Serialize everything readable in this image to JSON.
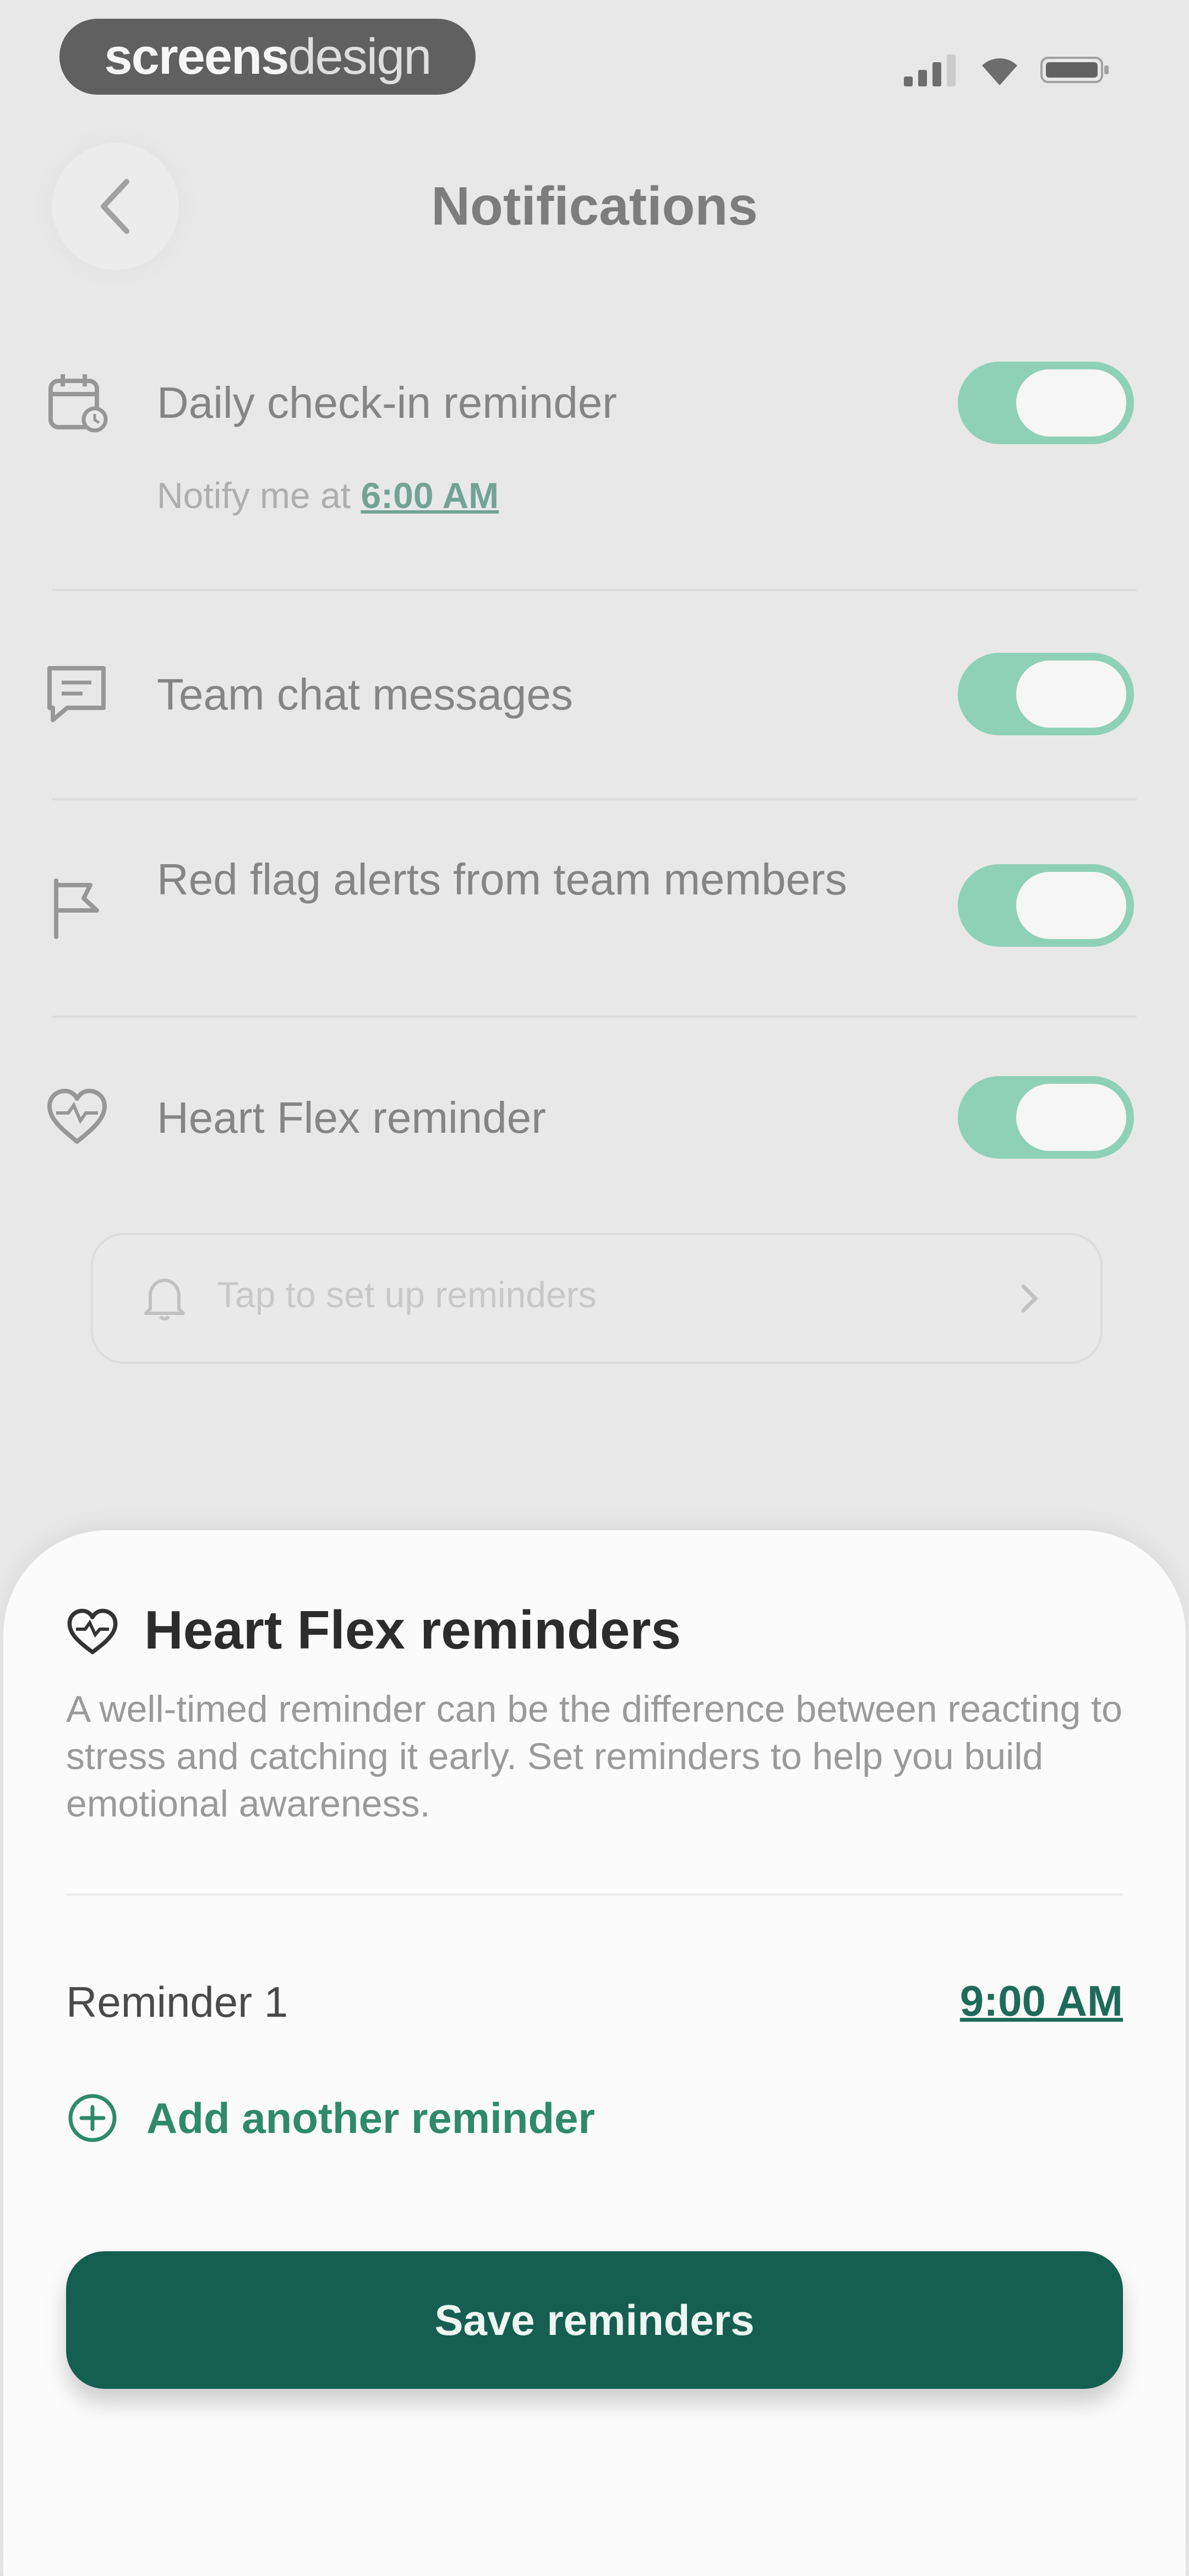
{
  "status_bar": {
    "brand_bold": "screens",
    "brand_light": "design"
  },
  "header": {
    "title": "Notifications"
  },
  "settings": [
    {
      "label": "Daily check-in reminder",
      "icon": "calendar-clock-icon",
      "enabled": true
    },
    {
      "label": "Team chat messages",
      "icon": "chat-icon",
      "enabled": true
    },
    {
      "label": "Red flag alerts from team members",
      "icon": "flag-icon",
      "enabled": true
    },
    {
      "label": "Heart Flex reminder",
      "icon": "heart-icon",
      "enabled": true
    }
  ],
  "daily_notify": {
    "prefix": "Notify me at",
    "time": "6:00 AM"
  },
  "setup_reminders": {
    "placeholder": "Tap to set up reminders"
  },
  "sheet": {
    "title": "Heart Flex reminders",
    "description": "A well-timed reminder can be the difference between reacting to stress and catching it early. Set reminders to help you build emotional awareness.",
    "reminders": [
      {
        "label": "Reminder 1",
        "time": "9:00 AM"
      }
    ],
    "add_label": "Add another reminder",
    "save_label": "Save reminders"
  },
  "colors": {
    "toggle_on": "#58c39b",
    "primary_button": "#155f51",
    "accent_text": "#2e8a6b"
  }
}
